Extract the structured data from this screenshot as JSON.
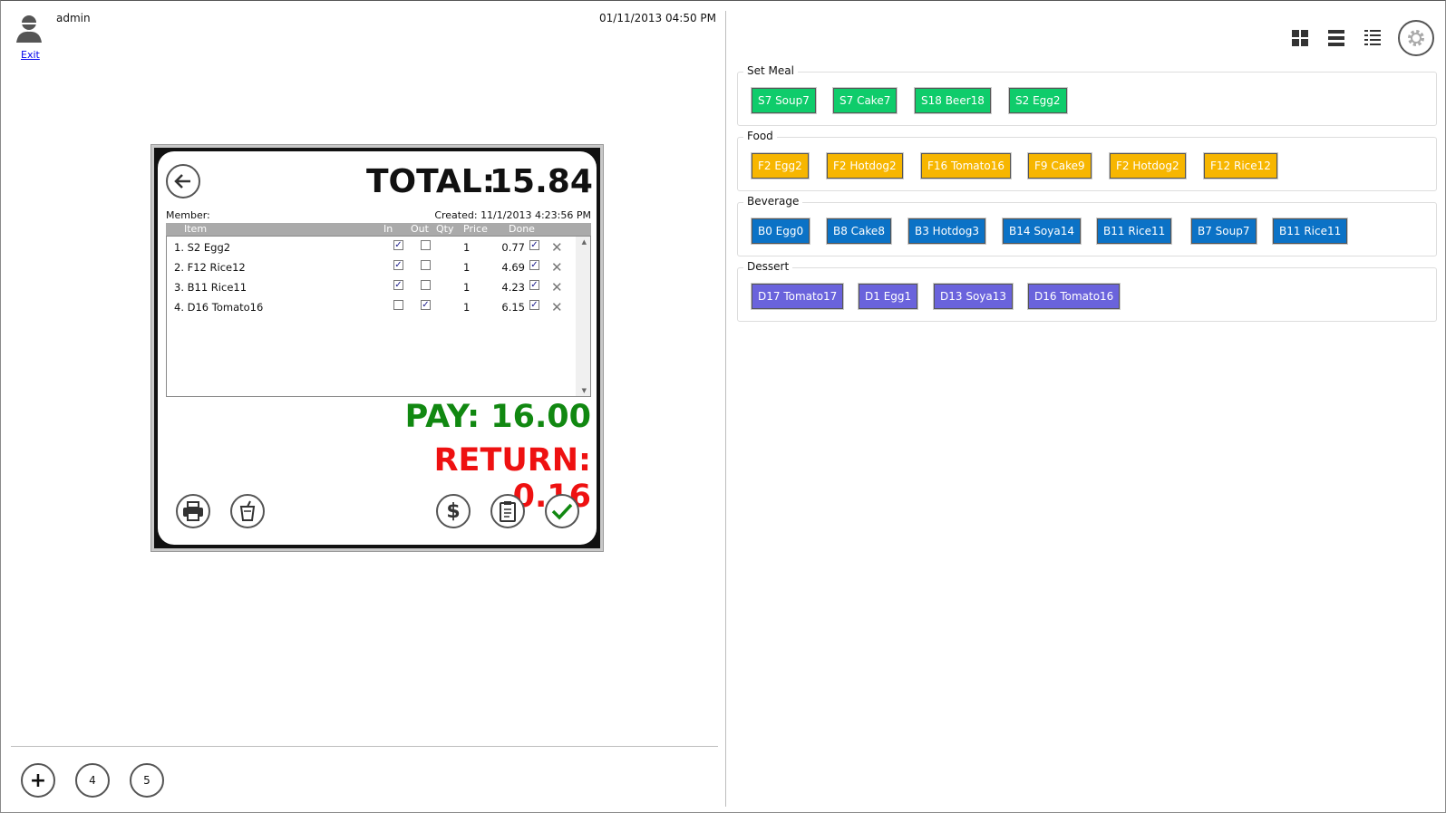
{
  "user": {
    "name": "admin",
    "exit_label": "Exit"
  },
  "datetime": "01/11/2013 04:50 PM",
  "order": {
    "total_label": "TOTAL:",
    "total_value": "15.84",
    "member_label": "Member:",
    "created_text": "Created: 11/1/2013 4:23:56 PM",
    "columns": {
      "item": "Item",
      "in": "In",
      "out": "Out",
      "qty": "Qty",
      "price": "Price",
      "done": "Done"
    },
    "items": [
      {
        "name": "1. S2 Egg2",
        "in": true,
        "out": false,
        "qty": "1",
        "price": "0.77",
        "done": true
      },
      {
        "name": "2. F12 Rice12",
        "in": true,
        "out": false,
        "qty": "1",
        "price": "4.69",
        "done": true
      },
      {
        "name": "3. B11 Rice11",
        "in": true,
        "out": false,
        "qty": "1",
        "price": "4.23",
        "done": true
      },
      {
        "name": "4. D16 Tomato16",
        "in": false,
        "out": true,
        "qty": "1",
        "price": "6.15",
        "done": true
      }
    ],
    "pay_text": "PAY: 16.00",
    "return_text": "RETURN: 0.16",
    "dollar_symbol": "$"
  },
  "tables": {
    "add_symbol": "+",
    "items": [
      "4",
      "5"
    ]
  },
  "menu": {
    "groups": [
      {
        "title": "Set Meal",
        "color": "#0fcc6b",
        "items": [
          "S7 Soup7",
          "S7 Cake7",
          "S18 Beer18",
          "S2 Egg2"
        ]
      },
      {
        "title": "Food",
        "color": "#f7b600",
        "items": [
          "F2 Egg2",
          "F2 Hotdog2",
          "F16 Tomato16",
          "F9 Cake9",
          "F2 Hotdog2",
          "F12 Rice12"
        ]
      },
      {
        "title": "Beverage",
        "color": "#0b72c6",
        "items": [
          "B0 Egg0",
          "B8 Cake8",
          "B3 Hotdog3",
          "B14 Soya14",
          "B11 Rice11",
          "B7 Soup7",
          "B11 Rice11"
        ]
      },
      {
        "title": "Dessert",
        "color": "#6a63dc",
        "items": [
          "D17 Tomato17",
          "D1 Egg1",
          "D13 Soya13",
          "D16 Tomato16"
        ]
      }
    ]
  }
}
